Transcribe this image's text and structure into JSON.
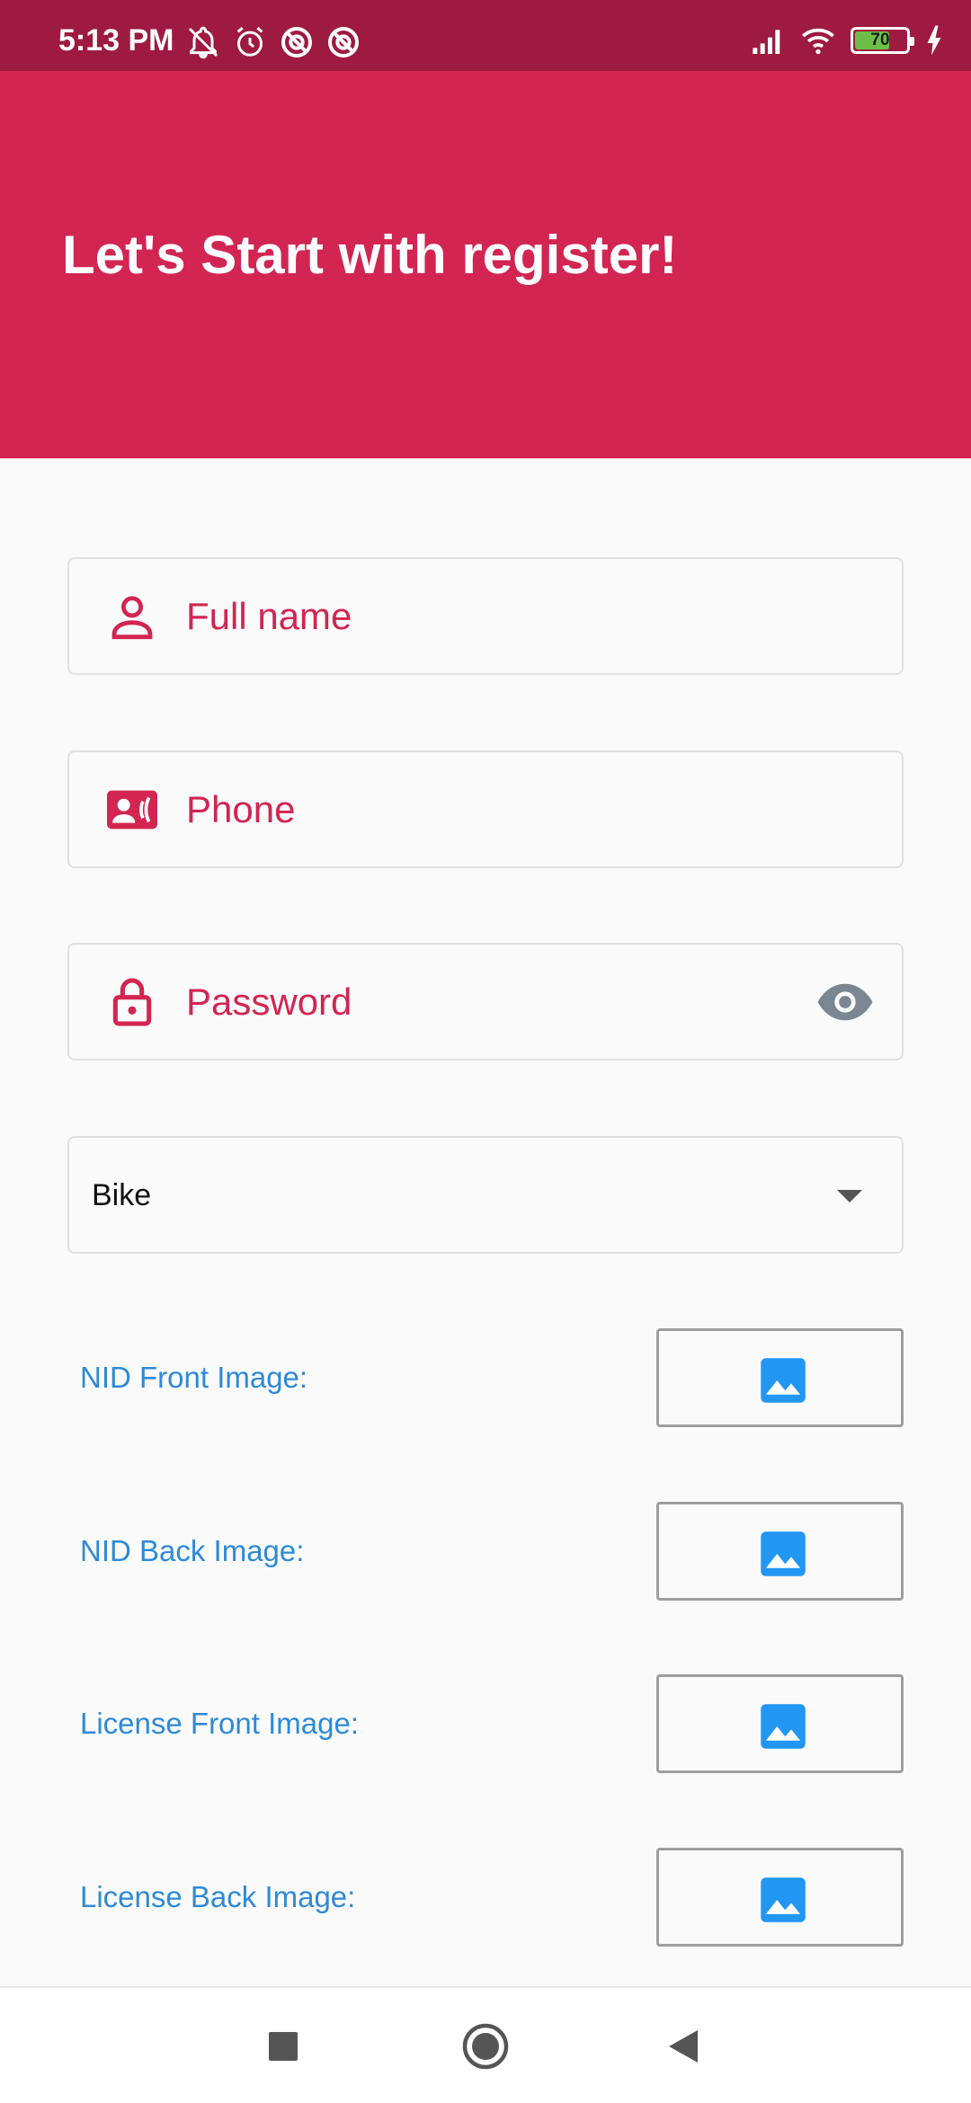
{
  "status_bar": {
    "time": "5:13 PM",
    "battery_level": "70",
    "battery_fraction": 0.7,
    "left_icons": [
      "bell-off-icon",
      "alarm-icon",
      "data-saver-icon",
      "data-saver-icon"
    ],
    "right_icons": [
      "signal-icon",
      "wifi-icon",
      "battery-icon",
      "charging-icon"
    ],
    "colors": {
      "background": "#9e1a40",
      "battery_fill": "#6cc04a"
    }
  },
  "header": {
    "title": "Let's Start with register!",
    "color": "#d22552"
  },
  "form": {
    "full_name": {
      "placeholder": "Full name",
      "icon": "person-icon"
    },
    "phone": {
      "placeholder": "Phone",
      "icon": "contact-phone-icon"
    },
    "password": {
      "placeholder": "Password",
      "icon": "lock-icon",
      "toggle_icon": "eye-icon"
    },
    "vehicle_type": {
      "selected": "Bike",
      "icon": "dropdown-arrow-icon"
    },
    "uploads": [
      {
        "label": "NID Front Image:",
        "icon": "image-icon"
      },
      {
        "label": "NID Back Image:",
        "icon": "image-icon"
      },
      {
        "label": "License Front Image:",
        "icon": "image-icon"
      },
      {
        "label": "License Back Image:",
        "icon": "image-icon"
      }
    ],
    "colors": {
      "accent": "#d22552",
      "label_blue": "#2e8ad8",
      "icon_blue": "#2196f3"
    }
  },
  "nav_bar": {
    "buttons": [
      "recents-icon",
      "home-icon",
      "back-icon"
    ]
  }
}
